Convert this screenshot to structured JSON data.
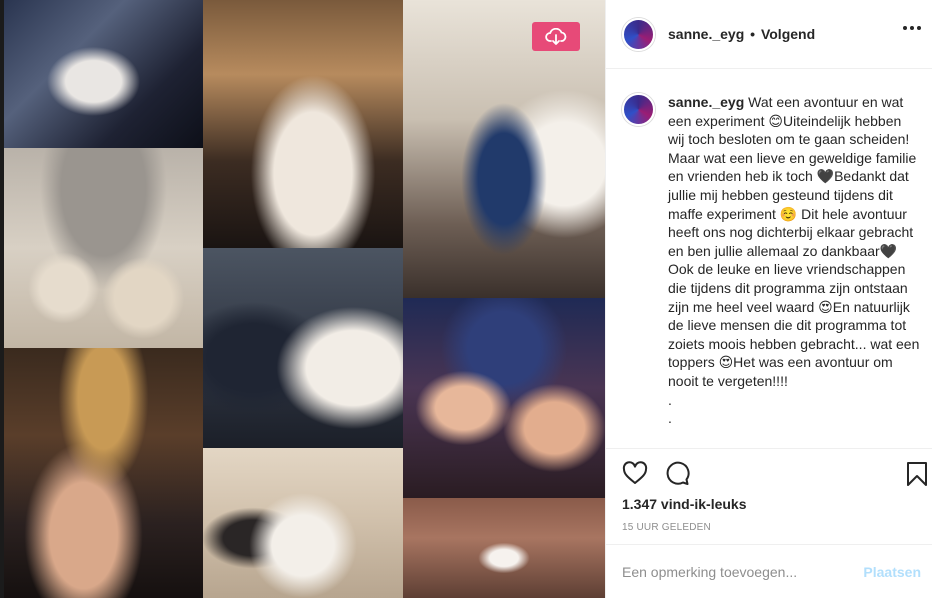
{
  "header": {
    "username": "sanne._eyg",
    "separator": "•",
    "follow_status": "Volgend",
    "more_icon": "more-horizontal-icon"
  },
  "media": {
    "download_icon": "cloud-download-icon",
    "download_button_color": "#e74a78",
    "tile_count": 9
  },
  "caption": {
    "username": "sanne._eyg",
    "text": "Wat een avontuur en wat een experiment 😊Uiteindelijk hebben wij toch besloten om te gaan scheiden! Maar wat een lieve en geweldige familie en vrienden heb ik toch 🖤Bedankt dat jullie mij hebben gesteund tijdens dit maffe experiment ☺️ Dit hele avontuur heeft ons nog dichterbij elkaar gebracht en ben jullie allemaal zo dankbaar🖤Ook de leuke en lieve vriendschappen die tijdens dit programma zijn ontstaan zijn me heel veel waard 😍En natuurlijk de lieve mensen die dit programma tot zoiets moois hebben gebracht... wat een toppers 😍Het was een avontuur om nooit te vergeten!!!!",
    "trailing_1": ".",
    "trailing_2": "."
  },
  "actions": {
    "like_icon": "heart-icon",
    "comment_icon": "comment-icon",
    "save_icon": "bookmark-icon"
  },
  "likes": "1.347 vind-ik-leuks",
  "timestamp": "15 UUR GELEDEN",
  "add_comment": {
    "placeholder": "Een opmerking toevoegen...",
    "post_label": "Plaatsen",
    "post_color": "#b2dffc"
  }
}
